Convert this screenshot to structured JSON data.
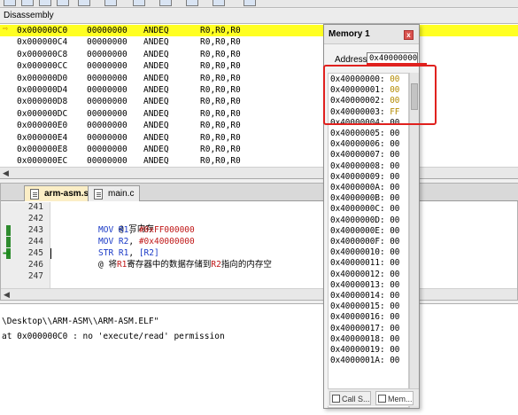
{
  "disassembly": {
    "title": "Disassembly",
    "rows": [
      {
        "addr": "0x000000C0",
        "hex": "00000000",
        "mnemonic": "ANDEQ",
        "operands": "R0,R0,R0",
        "current": true
      },
      {
        "addr": "0x000000C4",
        "hex": "00000000",
        "mnemonic": "ANDEQ",
        "operands": "R0,R0,R0"
      },
      {
        "addr": "0x000000C8",
        "hex": "00000000",
        "mnemonic": "ANDEQ",
        "operands": "R0,R0,R0"
      },
      {
        "addr": "0x000000CC",
        "hex": "00000000",
        "mnemonic": "ANDEQ",
        "operands": "R0,R0,R0"
      },
      {
        "addr": "0x000000D0",
        "hex": "00000000",
        "mnemonic": "ANDEQ",
        "operands": "R0,R0,R0"
      },
      {
        "addr": "0x000000D4",
        "hex": "00000000",
        "mnemonic": "ANDEQ",
        "operands": "R0,R0,R0"
      },
      {
        "addr": "0x000000D8",
        "hex": "00000000",
        "mnemonic": "ANDEQ",
        "operands": "R0,R0,R0"
      },
      {
        "addr": "0x000000DC",
        "hex": "00000000",
        "mnemonic": "ANDEQ",
        "operands": "R0,R0,R0"
      },
      {
        "addr": "0x000000E0",
        "hex": "00000000",
        "mnemonic": "ANDEQ",
        "operands": "R0,R0,R0"
      },
      {
        "addr": "0x000000E4",
        "hex": "00000000",
        "mnemonic": "ANDEQ",
        "operands": "R0,R0,R0"
      },
      {
        "addr": "0x000000E8",
        "hex": "00000000",
        "mnemonic": "ANDEQ",
        "operands": "R0,R0,R0"
      },
      {
        "addr": "0x000000EC",
        "hex": "00000000",
        "mnemonic": "ANDEQ",
        "operands": "R0,R0,R0"
      }
    ]
  },
  "editor": {
    "tabs": [
      {
        "label": "arm-asm.s",
        "active": true
      },
      {
        "label": "main.c",
        "active": false
      }
    ],
    "line_numbers": [
      "241",
      "242",
      "243",
      "244",
      "245",
      "246",
      "247"
    ],
    "current_line": "245",
    "code": {
      "l242": "@ 写内存",
      "l243_kw": "MOV",
      "l243_reg": "R1",
      "l243_num": "#0xFF000000",
      "l244_kw": "MOV",
      "l244_reg": "R2",
      "l244_num": "#0x40000000",
      "l245_kw": "STR",
      "l245_reg": "R1",
      "l245_op": "[R2]",
      "l246_a": "@ 将",
      "l246_r1": "R1",
      "l246_b": "寄存器中的数据存储到",
      "l246_r2": "R2",
      "l246_c": "指向的内存空"
    }
  },
  "output": {
    "lines": [
      "\\Desktop\\\\ARM-ASM\\\\ARM-ASM.ELF\"",
      "at 0x000000C0 : no 'execute/read' permission"
    ]
  },
  "memory": {
    "title": "Memory 1",
    "close_label": "x",
    "address_label": "Address:",
    "address_value": "0x40000000",
    "rows": [
      {
        "addr": "0x40000000:",
        "val": "00"
      },
      {
        "addr": "0x40000001:",
        "val": "00"
      },
      {
        "addr": "0x40000002:",
        "val": "00"
      },
      {
        "addr": "0x40000003:",
        "val": "FF"
      },
      {
        "addr": "0x40000004:",
        "val": "00"
      },
      {
        "addr": "0x40000005:",
        "val": "00"
      },
      {
        "addr": "0x40000006:",
        "val": "00"
      },
      {
        "addr": "0x40000007:",
        "val": "00"
      },
      {
        "addr": "0x40000008:",
        "val": "00"
      },
      {
        "addr": "0x40000009:",
        "val": "00"
      },
      {
        "addr": "0x4000000A:",
        "val": "00"
      },
      {
        "addr": "0x4000000B:",
        "val": "00"
      },
      {
        "addr": "0x4000000C:",
        "val": "00"
      },
      {
        "addr": "0x4000000D:",
        "val": "00"
      },
      {
        "addr": "0x4000000E:",
        "val": "00"
      },
      {
        "addr": "0x4000000F:",
        "val": "00"
      },
      {
        "addr": "0x40000010:",
        "val": "00"
      },
      {
        "addr": "0x40000011:",
        "val": "00"
      },
      {
        "addr": "0x40000012:",
        "val": "00"
      },
      {
        "addr": "0x40000013:",
        "val": "00"
      },
      {
        "addr": "0x40000014:",
        "val": "00"
      },
      {
        "addr": "0x40000015:",
        "val": "00"
      },
      {
        "addr": "0x40000016:",
        "val": "00"
      },
      {
        "addr": "0x40000017:",
        "val": "00"
      },
      {
        "addr": "0x40000018:",
        "val": "00"
      },
      {
        "addr": "0x40000019:",
        "val": "00"
      },
      {
        "addr": "0x4000001A:",
        "val": "00"
      }
    ],
    "bottom_tabs": [
      {
        "label": "Call S...",
        "active": false
      },
      {
        "label": "Mem...",
        "active": true
      }
    ]
  },
  "colors": {
    "current_line": "#ffff22",
    "annotation": "#e0211e",
    "mem_changed": "#b38a00",
    "keyword": "#1a3ac7",
    "number": "#c01818"
  }
}
